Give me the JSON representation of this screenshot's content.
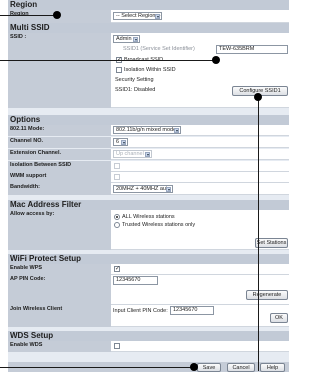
{
  "region": {
    "section_title": "Region",
    "label": "Region",
    "select_value": "-- Select Region --"
  },
  "multi_ssid": {
    "section_title": "Multi SSID",
    "ssid_label": "SSID :",
    "ssid_select_value": "Admin",
    "ssid_field_placeholder": "SSID1 (Service Set Identifier)",
    "ssid_field_value": "TEW-635BRM",
    "broadcast_label": "Broadcast SSID",
    "broadcast_checked": true,
    "isolation_label": "Isolation Within SSID",
    "isolation_checked": false,
    "security_label": "Security Setting",
    "security_status": "SSID1: Disabled",
    "configure_button": "Configure SSID1"
  },
  "options": {
    "section_title": "Options",
    "mode_label": "802.11 Mode:",
    "mode_value": "802.11b/g/n mixed mode",
    "channel_label": "Channel NO.",
    "channel_value": "6",
    "ext_channel_label": "Extension Channel.",
    "ext_channel_value": "Up channel",
    "isolation_between_label": "Isolation Between SSID",
    "wmm_label": "WMM support",
    "bandwidth_label": "Bandwidth:",
    "bandwidth_value": "20MHZ + 40MHZ auto"
  },
  "mac_filter": {
    "section_title": "Mac Address Filter",
    "allow_label": "Allow access by:",
    "option_all": "ALL Wireless stations",
    "option_trusted": "Trusted Wireless stations only",
    "stations_button": "Set Stations"
  },
  "wps": {
    "section_title": "WiFi Protect Setup",
    "enable_label": "Enable WPS",
    "enable_checked": true,
    "pin_label": "AP PIN Code:",
    "pin_value": "12345670",
    "regenerate_button": "Regenerate",
    "join_label": "Join Wireless Client",
    "client_pin_label": "Input Client PIN Code:",
    "client_pin_value": "12345670",
    "ok_button": "OK"
  },
  "wds": {
    "section_title": "WDS Setup",
    "enable_label": "Enable WDS",
    "enable_checked": false
  },
  "footer": {
    "save_button": "Save",
    "cancel_button": "Cancel",
    "help_button": "Help"
  }
}
